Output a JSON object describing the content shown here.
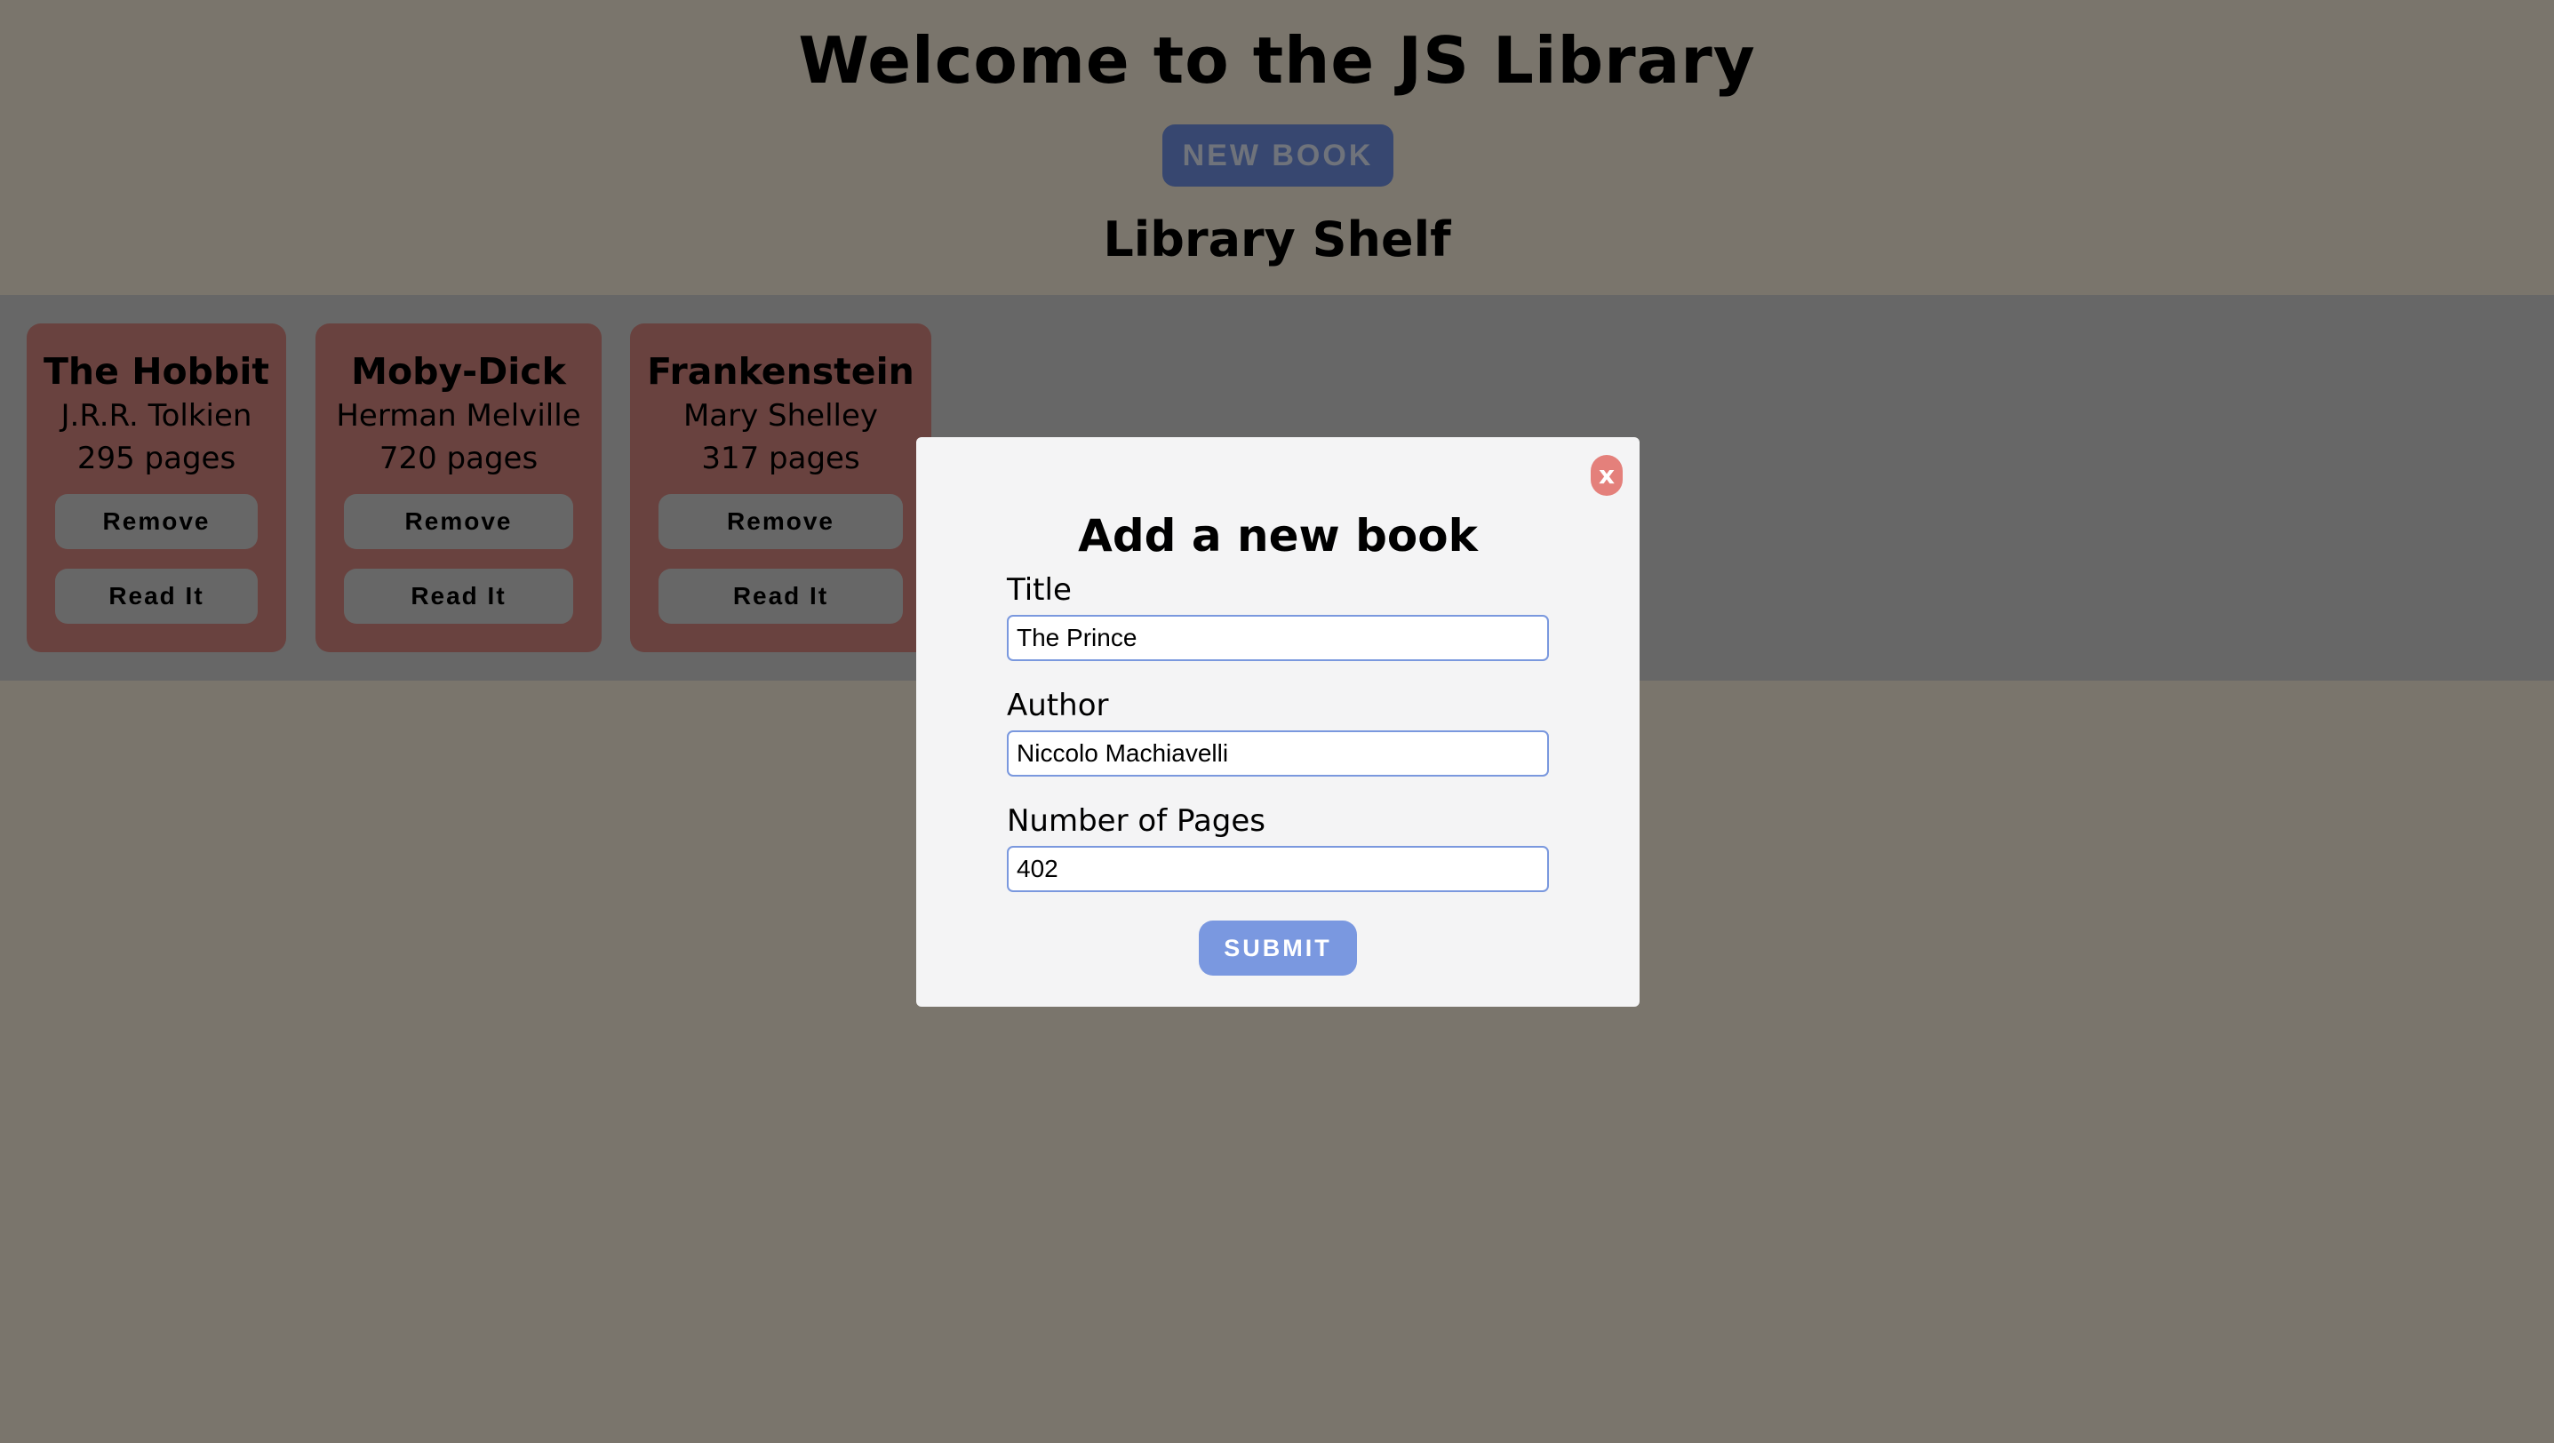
{
  "header": {
    "title": "Welcome to the JS Library",
    "new_book_label": "NEW BOOK",
    "shelf_title": "Library Shelf"
  },
  "books": [
    {
      "title": "The Hobbit",
      "author": "J.R.R. Tolkien",
      "pages": "295 pages",
      "remove_label": "Remove",
      "read_label": "Read It"
    },
    {
      "title": "Moby-Dick",
      "author": "Herman Melville",
      "pages": "720 pages",
      "remove_label": "Remove",
      "read_label": "Read It"
    },
    {
      "title": "Frankenstein",
      "author": "Mary Shelley",
      "pages": "317 pages",
      "remove_label": "Remove",
      "read_label": "Read It"
    }
  ],
  "modal": {
    "close_label": "x",
    "title": "Add a new book",
    "title_label": "Title",
    "title_value": "The Prince",
    "author_label": "Author",
    "author_value": "Niccolo Machiavelli",
    "pages_label": "Number of Pages",
    "pages_value": "402",
    "submit_label": "SUBMIT"
  },
  "colors": {
    "page_background": "#f4ead8",
    "card": "#d2847e",
    "accent": "#7a98e0",
    "close": "#e4807b"
  }
}
